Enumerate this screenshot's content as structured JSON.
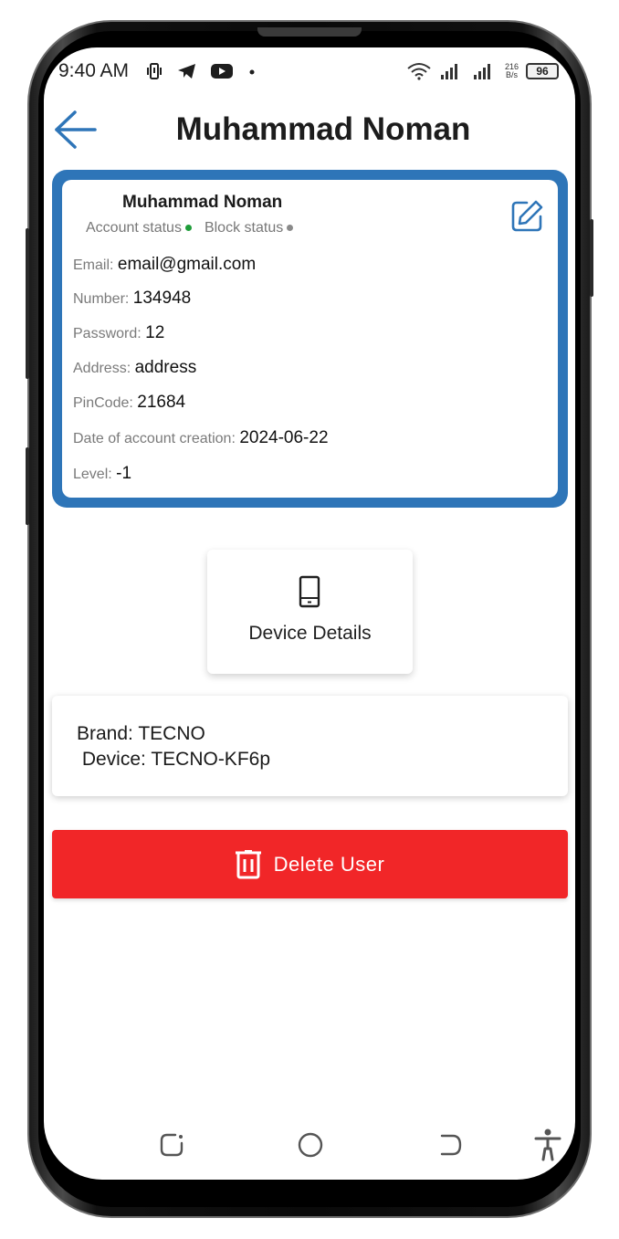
{
  "status_bar": {
    "time": "9:40 AM",
    "net_speed_value": "216",
    "net_speed_unit": "B/s",
    "battery": "96"
  },
  "header": {
    "title": "Muhammad Noman"
  },
  "profile": {
    "name": "Muhammad Noman",
    "account_status_label": "Account status",
    "account_status_color": "#1f9d3a",
    "block_status_label": "Block status",
    "block_status_color": "#8a8a8a",
    "fields": [
      {
        "label": "Email: ",
        "value": "email@gmail.com"
      },
      {
        "label": "Number: ",
        "value": "134948"
      },
      {
        "label": "Password: ",
        "value": "12"
      },
      {
        "label": "Address: ",
        "value": "address"
      },
      {
        "label": "PinCode: ",
        "value": "21684"
      },
      {
        "label": "Date of account creation: ",
        "value": "2024-06-22"
      },
      {
        "label": "Level: ",
        "value": "-1"
      }
    ]
  },
  "device_button": {
    "label": "Device Details",
    "icon": "phone-device-icon"
  },
  "device_info": {
    "brand_line": "Brand: TECNO",
    "device_line": " Device: TECNO-KF6p"
  },
  "delete_button": {
    "label": "Delete User",
    "icon": "trash-icon",
    "color": "#f12628"
  },
  "colors": {
    "accent_blue": "#2e75b8"
  }
}
